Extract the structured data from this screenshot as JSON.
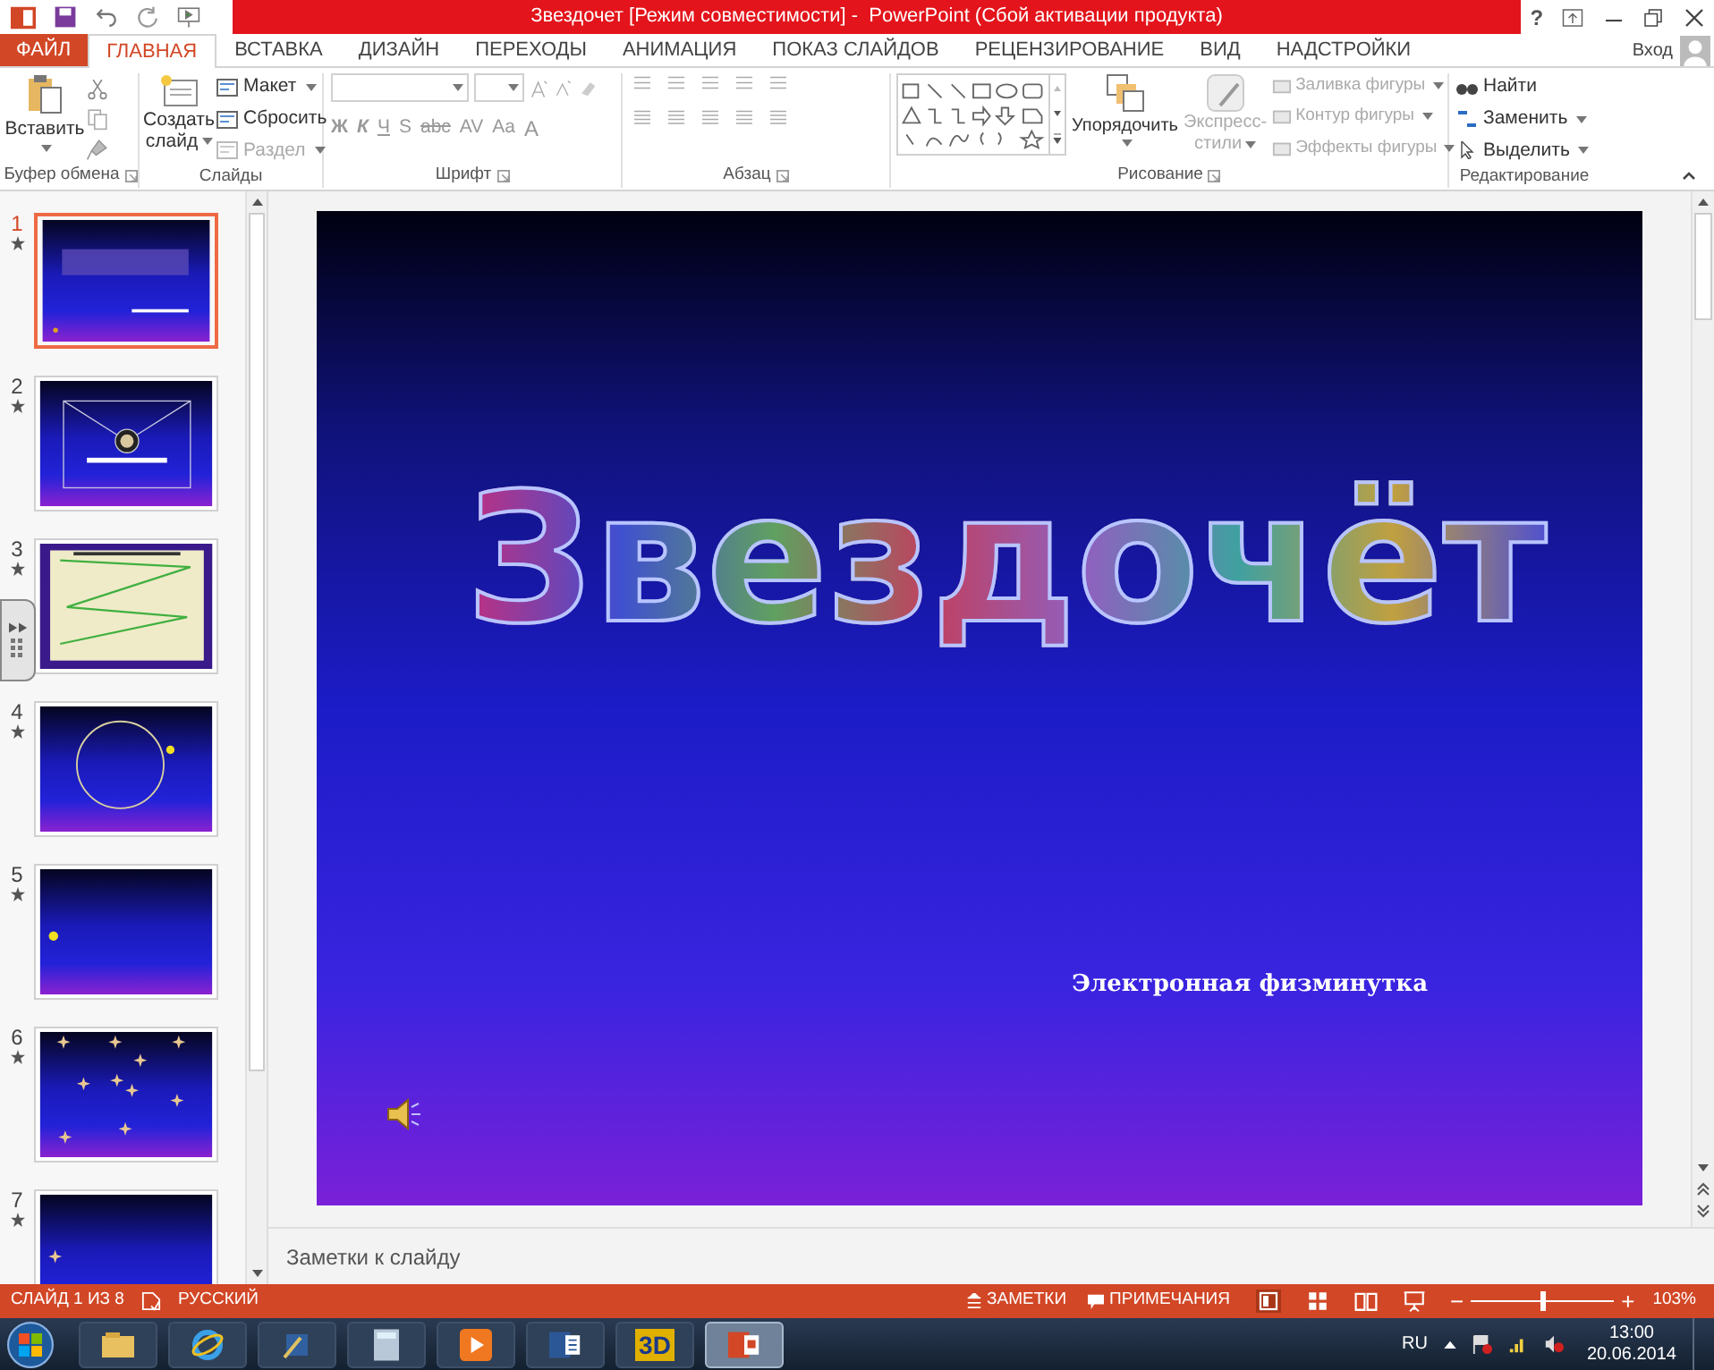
{
  "window": {
    "title": "Звездочет [Режим совместимости] -  PowerPoint (Сбой активации продукта)",
    "help": "?",
    "sign_in": "Вход"
  },
  "tabs": [
    {
      "label": "ФАЙЛ",
      "kind": "file",
      "selected": false
    },
    {
      "label": "ГЛАВНАЯ",
      "kind": "tab",
      "selected": true
    },
    {
      "label": "ВСТАВКА",
      "kind": "tab",
      "selected": false
    },
    {
      "label": "ДИЗАЙН",
      "kind": "tab",
      "selected": false
    },
    {
      "label": "ПЕРЕХОДЫ",
      "kind": "tab",
      "selected": false
    },
    {
      "label": "АНИМАЦИЯ",
      "kind": "tab",
      "selected": false
    },
    {
      "label": "ПОКАЗ СЛАЙДОВ",
      "kind": "tab",
      "selected": false
    },
    {
      "label": "РЕЦЕНЗИРОВАНИЕ",
      "kind": "tab",
      "selected": false
    },
    {
      "label": "ВИД",
      "kind": "tab",
      "selected": false
    },
    {
      "label": "НАДСТРОЙКИ",
      "kind": "tab",
      "selected": false
    }
  ],
  "ribbon": {
    "clipboard": {
      "name": "Буфер обмена",
      "paste": "Вставить"
    },
    "slides": {
      "name": "Слайды",
      "new_slide": [
        "Создать",
        "слайд"
      ],
      "items": [
        {
          "label": "Макет",
          "disabled": false
        },
        {
          "label": "Сбросить",
          "disabled": false
        },
        {
          "label": "Раздел",
          "disabled": true
        }
      ]
    },
    "font": {
      "name": "Шрифт",
      "buttons": [
        "Ж",
        "К",
        "Ч",
        "S",
        "abc",
        "AV",
        "Aa",
        "A"
      ]
    },
    "paragraph": {
      "name": "Абзац"
    },
    "drawing": {
      "name": "Рисование",
      "arrange": "Упорядочить",
      "quick_styles": [
        "Экспресс-",
        "стили"
      ],
      "quick_styles_disabled": true,
      "items": [
        {
          "label": "Заливка фигуры",
          "disabled": true
        },
        {
          "label": "Контур фигуры",
          "disabled": true
        },
        {
          "label": "Эффекты фигуры",
          "disabled": true
        }
      ]
    },
    "editing": {
      "name": "Редактирование",
      "items": [
        {
          "label": "Найти",
          "kind": "find"
        },
        {
          "label": "Заменить",
          "kind": "replace"
        },
        {
          "label": "Выделить",
          "kind": "select"
        }
      ]
    }
  },
  "slides_panel": [
    {
      "number": "1",
      "selected": true,
      "animated": true,
      "kind": "title"
    },
    {
      "number": "2",
      "selected": false,
      "animated": true,
      "kind": "envelope"
    },
    {
      "number": "3",
      "selected": false,
      "animated": true,
      "kind": "map"
    },
    {
      "number": "4",
      "selected": false,
      "animated": true,
      "kind": "orbit"
    },
    {
      "number": "5",
      "selected": false,
      "animated": true,
      "kind": "dot"
    },
    {
      "number": "6",
      "selected": false,
      "animated": true,
      "kind": "stars"
    },
    {
      "number": "7",
      "selected": false,
      "animated": true,
      "kind": "star"
    }
  ],
  "slide": {
    "title": "Звездочёт",
    "subtitle": "Электронная физминутка"
  },
  "notes": {
    "placeholder": "Заметки к слайду"
  },
  "status_bar": {
    "slide_counter": "СЛАЙД 1 ИЗ 8",
    "language": "РУССКИЙ",
    "notes": "ЗАМЕТКИ",
    "comments": "ПРИМЕЧАНИЯ",
    "zoom_out": "−",
    "zoom": {
      "level": 0.5
    },
    "zoom_in": "+",
    "zoom_text": "103%"
  },
  "taskbar": {
    "apps": [
      {
        "kind": "explorer",
        "selected": false
      },
      {
        "kind": "ie",
        "selected": false
      },
      {
        "kind": "tool",
        "selected": false
      },
      {
        "kind": "calculator",
        "selected": false
      },
      {
        "kind": "media",
        "selected": false
      },
      {
        "kind": "word",
        "selected": false
      },
      {
        "kind": "threed",
        "label": "3D",
        "selected": false
      },
      {
        "kind": "powerpoint",
        "selected": true
      }
    ],
    "language": "RU",
    "time": "13:00",
    "date": "20.06.2014"
  }
}
